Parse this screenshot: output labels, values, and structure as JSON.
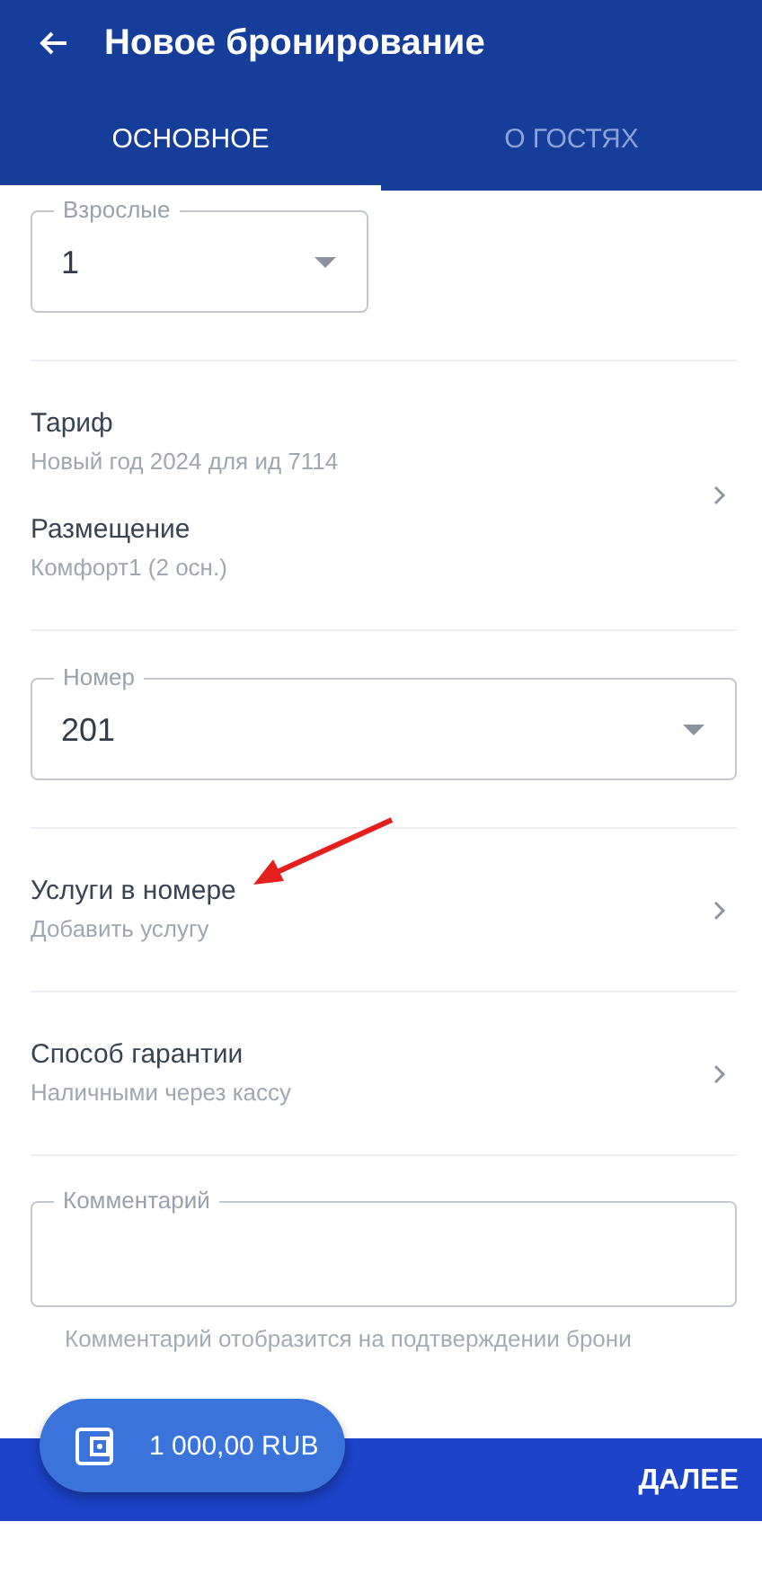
{
  "header": {
    "title": "Новое бронирование"
  },
  "tabs": [
    {
      "label": "ОСНОВНОЕ",
      "selected": true
    },
    {
      "label": "О ГОСТЯХ",
      "selected": false
    }
  ],
  "sections": [
    {
      "kind": "select",
      "label": "Взрослые",
      "value": "1"
    },
    {
      "kind": "links",
      "items": [
        {
          "title": "Тариф",
          "subtitle": "Новый год 2024 для ид 7114"
        },
        {
          "title": "Размещение",
          "subtitle": "Комфорт1 (2 осн.)"
        }
      ]
    },
    {
      "kind": "select",
      "label": "Номер",
      "value": "201"
    },
    {
      "kind": "links",
      "items": [
        {
          "title": "Услуги в номере",
          "subtitle": "Добавить услугу"
        }
      ]
    },
    {
      "kind": "links",
      "items": [
        {
          "title": "Способ гарантии",
          "subtitle": "Наличными через кассу"
        }
      ]
    },
    {
      "kind": "textarea",
      "label": "Комментарий",
      "helper": "Комментарий отобразится на подтверждении брони"
    }
  ],
  "total": {
    "amount": "1 000,00 RUB"
  },
  "footer": {
    "next": "ДАЛЕЕ"
  }
}
